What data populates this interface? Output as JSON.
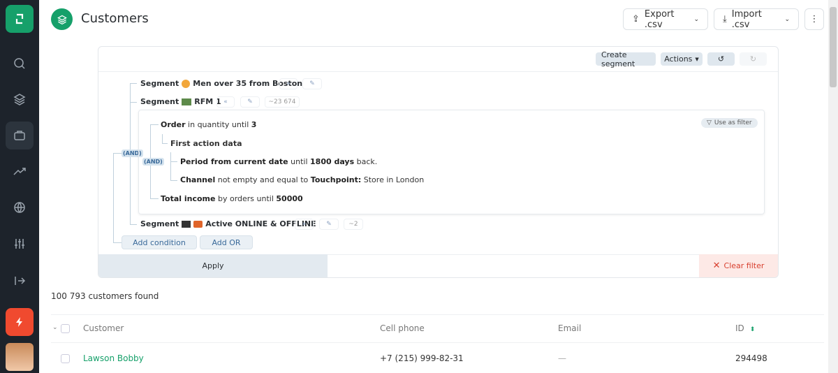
{
  "header": {
    "title": "Customers",
    "export_label": "Export .csv",
    "import_label": "Import .csv"
  },
  "toolbar": {
    "create_segment": "Create segment",
    "actions": "Actions"
  },
  "filter": {
    "segments": [
      {
        "prefix": "Segment",
        "name": "Men over 35 from Boston"
      },
      {
        "prefix": "Segment",
        "name": "RFM 1",
        "count": "~23 674"
      },
      {
        "prefix": "Segment",
        "name": "Active ONLINE & OFFLINE",
        "count": "~2"
      }
    ],
    "use_as_filter": "Use as filter",
    "and_label": "(AND)",
    "conditions": {
      "order": {
        "b1": "Order",
        "t1": " in quantity until ",
        "b2": "3"
      },
      "first_action": "First action data",
      "period": {
        "b1": "Period from current date",
        "t1": " until ",
        "b2": "1800 days",
        "t2": " back."
      },
      "channel": {
        "b1": "Channel",
        "t1": " not empty and equal to ",
        "b2": "Touchpoint:",
        "t2": " Store in London"
      },
      "income": {
        "b1": "Total income",
        "t1": " by orders until ",
        "b2": "50000"
      }
    },
    "add_condition": "Add condition",
    "add_or": "Add OR",
    "apply": "Apply",
    "clear": "Clear filter"
  },
  "results": {
    "count_text": "100 793 customers found"
  },
  "table": {
    "columns": [
      "Customer",
      "Cell phone",
      "Email",
      "ID"
    ],
    "rows": [
      {
        "customer": "Lawson Bobby",
        "phone": "+7 (215) 999-82-31",
        "email": "—",
        "id": "294498"
      }
    ]
  },
  "colors": {
    "accent": "#16a06a",
    "sidebar": "#1d232b",
    "danger": "#e5483a"
  }
}
